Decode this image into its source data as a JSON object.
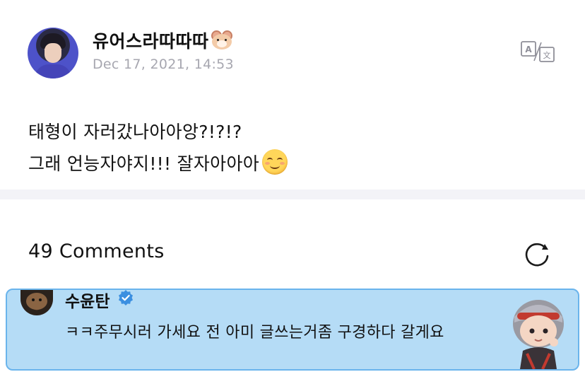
{
  "post": {
    "username": "유어스라따따따",
    "username_emoji": "hamster-face",
    "timestamp": "Dec 17, 2021, 14:53",
    "lines": [
      "태형이 자러갔나아아앙?!?!?",
      "그래 언능자야지!!! 잘자아아아"
    ],
    "trailing_emoji": "smiling-face-with-smiling-eyes"
  },
  "comments": {
    "count_label": "49 Comments",
    "items": [
      {
        "author": "수윤탄",
        "verified": true,
        "text": "ㅋㅋ주무시러 가세요 전 아미 글쓰는거좀 구경하다 갈게요",
        "sticker": "tinytan-character"
      }
    ]
  },
  "colors": {
    "timestamp": "#a7a7b0",
    "divider": "#f3f3f7",
    "highlight_bg": "#b5dcf6",
    "highlight_border": "#6ab4ec",
    "verified": "#3b8fe0"
  },
  "icons": {
    "translate": "translate-icon",
    "refresh": "refresh-icon",
    "verified": "verified-badge-icon"
  }
}
